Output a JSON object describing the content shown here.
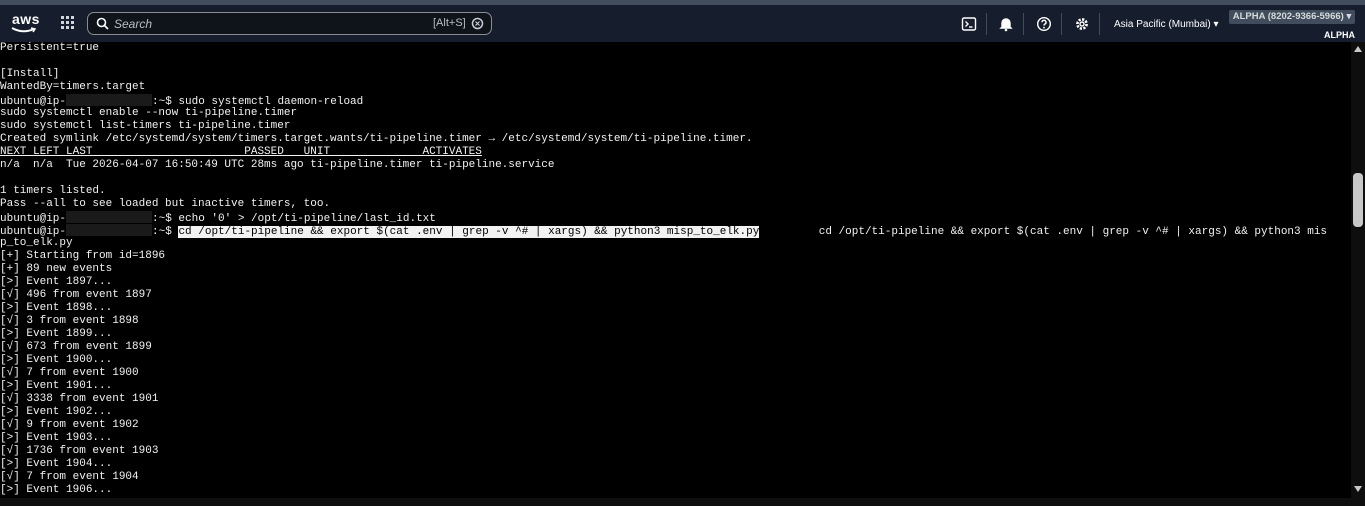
{
  "header": {
    "logo_text": "aws",
    "search": {
      "placeholder": "Search",
      "shortcut": "[Alt+S]"
    },
    "region": "Asia Pacific (Mumbai) ▾",
    "account": "ALPHA (8202-9366-5966) ▾",
    "account_alias": "ALPHA"
  },
  "icons": {
    "logo": "aws-smile-icon",
    "apps": "grid-icon",
    "search": "search-icon",
    "cloudshell": "terminal-icon",
    "notifications": "bell-icon",
    "help": "help-icon",
    "settings": "gear-icon"
  },
  "terminal": {
    "cwd_prompt_suffix": ":~$",
    "lines": [
      "Persistent=true",
      "",
      "[Install]",
      "WantedBy=timers.target",
      "ubuntu@ip-[REDACTED]:~$ sudo systemctl daemon-reload",
      "sudo systemctl enable --now ti-pipeline.timer",
      "sudo systemctl list-timers ti-pipeline.timer",
      "Created symlink /etc/systemd/system/timers.target.wants/ti-pipeline.timer → /etc/systemd/system/ti-pipeline.timer.",
      "NEXT LEFT LAST                       PASSED   UNIT              ACTIVATES",
      "n/a  n/a  Tue 2026-04-07 16:50:49 UTC 28ms ago ti-pipeline.timer ti-pipeline.service",
      "",
      "1 timers listed.",
      "Pass --all to see loaded but inactive timers, too.",
      "ubuntu@ip-[REDACTED]:~$ echo '0' > /opt/ti-pipeline/last_id.txt",
      "ubuntu@ip-[REDACTED]:~$ cd /opt/ti-pipeline && export $(cat .env | grep -v ^# | xargs) && python3 misp_to_elk.py         cd /opt/ti-pipeline && export $(cat .env | grep -v ^# | xargs) && python3 mis",
      "p_to_elk.py",
      "[+] Starting from id=1896",
      "[+] 89 new events",
      "[>] Event 1897...",
      "[√] 496 from event 1897",
      "[>] Event 1898...",
      "[√] 3 from event 1898",
      "[>] Event 1899...",
      "[√] 673 from event 1899",
      "[>] Event 1900...",
      "[√] 7 from event 1900",
      "[>] Event 1901...",
      "[√] 3338 from event 1901",
      "[>] Event 1902...",
      "[√] 9 from event 1902",
      "[>] Event 1903...",
      "[√] 1736 from event 1903",
      "[>] Event 1904...",
      "[√] 7 from event 1904",
      "[>] Event 1906..."
    ]
  },
  "colors": {
    "nav_bg": "#161e2d",
    "terminal_bg": "#000000",
    "terminal_fg": "#f2f2f2",
    "selection_bg": "#f2f2f2"
  }
}
